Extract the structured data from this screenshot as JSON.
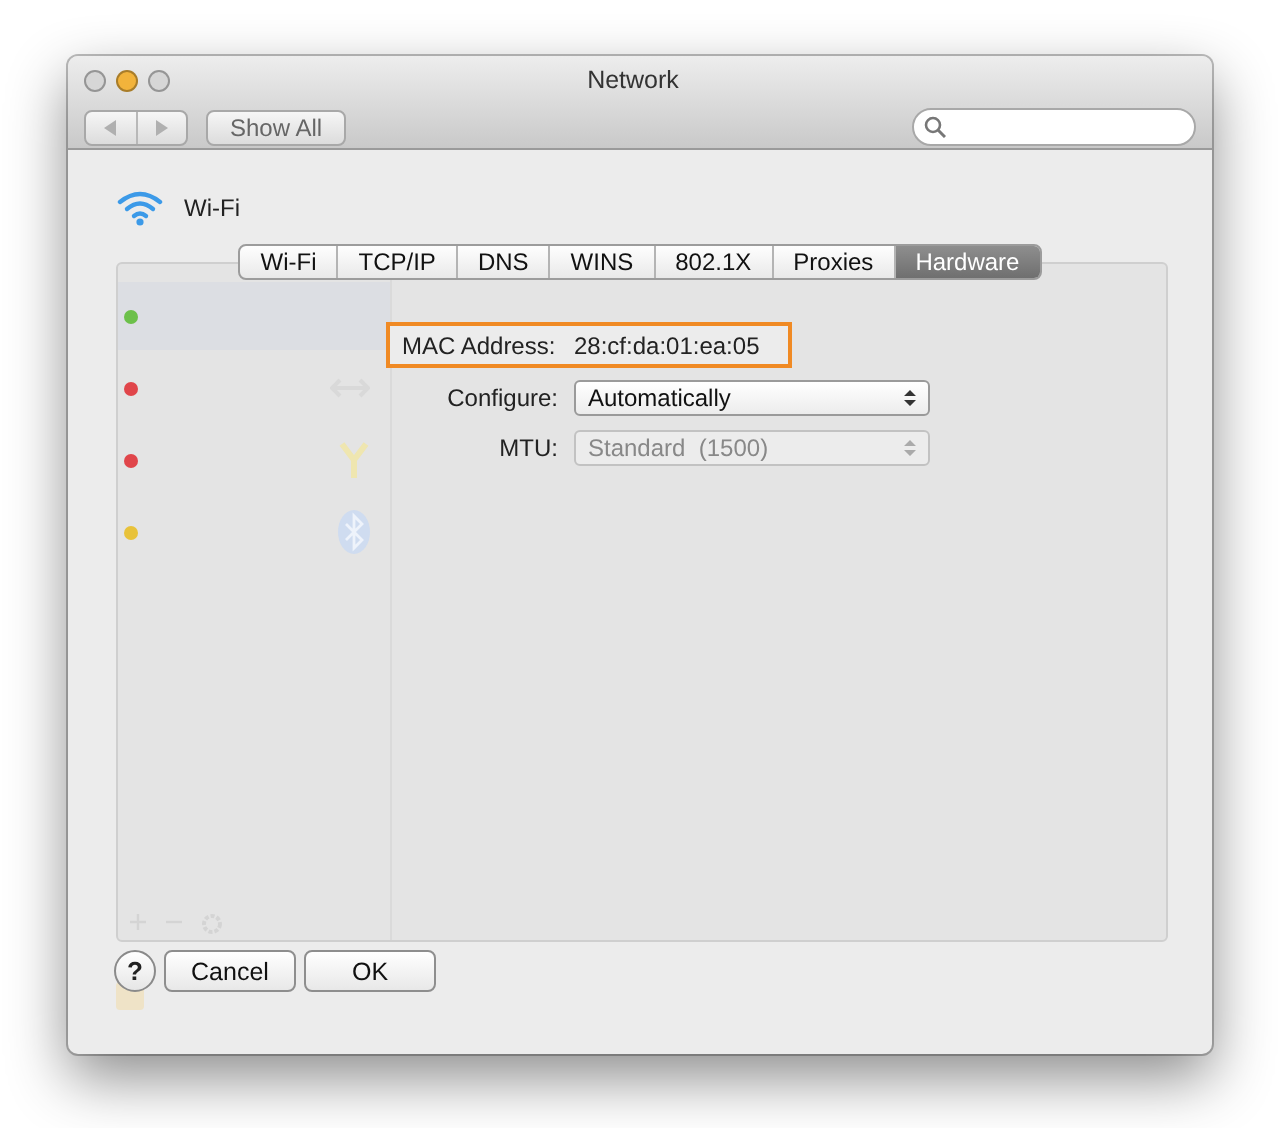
{
  "window": {
    "title": "Network"
  },
  "toolbar": {
    "show_all": "Show All"
  },
  "service": {
    "name": "Wi-Fi"
  },
  "services": [
    {
      "color": "#6cc04a",
      "kind": "wifi"
    },
    {
      "color": "#e0454a",
      "kind": "ethernet"
    },
    {
      "color": "#e0454a",
      "kind": "firewire"
    },
    {
      "color": "#e8c23a",
      "kind": "bluetooth"
    }
  ],
  "sheet": {
    "tabs": [
      {
        "label": "Wi-Fi",
        "selected": false
      },
      {
        "label": "TCP/IP",
        "selected": false
      },
      {
        "label": "DNS",
        "selected": false
      },
      {
        "label": "WINS",
        "selected": false
      },
      {
        "label": "802.1X",
        "selected": false
      },
      {
        "label": "Proxies",
        "selected": false
      },
      {
        "label": "Hardware",
        "selected": true
      }
    ],
    "mac": {
      "label": "MAC Address:",
      "value": "28:cf:da:01:ea:05"
    },
    "configure": {
      "label": "Configure:",
      "value": "Automatically",
      "disabled": false
    },
    "mtu": {
      "label": "MTU:",
      "value": "Standard  (1500)",
      "disabled": true
    },
    "help": "?",
    "cancel": "Cancel",
    "ok": "OK"
  }
}
